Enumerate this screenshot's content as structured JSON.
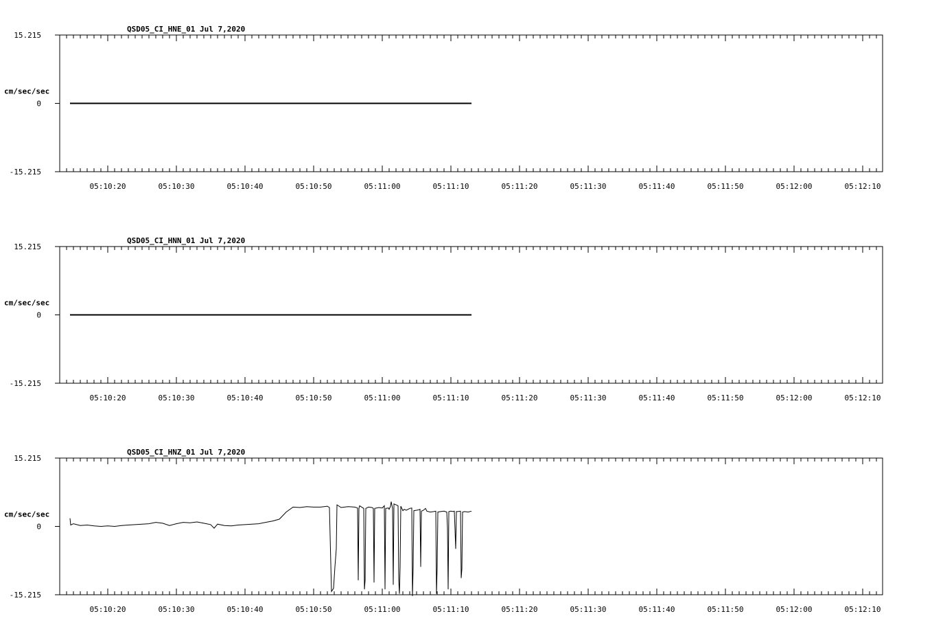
{
  "chart_data": [
    {
      "type": "line",
      "title": "QSD05_CI_HNE_01  Jul 7,2020",
      "ylabel": "cm/sec/sec",
      "ylim": [
        -15.215,
        15.215
      ],
      "ytick_labels": [
        "15.215",
        "0",
        "-15.215"
      ],
      "xtick_labels": [
        "05:10:20",
        "05:10:30",
        "05:10:40",
        "05:10:50",
        "05:11:00",
        "05:11:10",
        "05:11:20",
        "05:11:30",
        "05:11:40",
        "05:11:50",
        "05:12:00",
        "05:12:10"
      ],
      "series": [
        {
          "x_start_s": 14.5,
          "x_end_s": 73.0,
          "values": [
            [
              14.5,
              0.0
            ],
            [
              73.0,
              0.0
            ]
          ]
        }
      ]
    },
    {
      "type": "line",
      "title": "QSD05_CI_HNN_01  Jul 7,2020",
      "ylabel": "cm/sec/sec",
      "ylim": [
        -15.215,
        15.215
      ],
      "ytick_labels": [
        "15.215",
        "0",
        "-15.215"
      ],
      "xtick_labels": [
        "05:10:20",
        "05:10:30",
        "05:10:40",
        "05:10:50",
        "05:11:00",
        "05:11:10",
        "05:11:20",
        "05:11:30",
        "05:11:40",
        "05:11:50",
        "05:12:00",
        "05:12:10"
      ],
      "series": [
        {
          "values": [
            [
              14.5,
              0.0
            ],
            [
              73.0,
              0.0
            ]
          ]
        }
      ]
    },
    {
      "type": "line",
      "title": "QSD05_CI_HNZ_01  Jul 7,2020",
      "ylabel": "cm/sec/sec",
      "ylim": [
        -15.215,
        15.215
      ],
      "ytick_labels": [
        "15.215",
        "0",
        "-15.215"
      ],
      "xtick_labels": [
        "05:10:20",
        "05:10:30",
        "05:10:40",
        "05:10:50",
        "05:11:00",
        "05:11:10",
        "05:11:20",
        "05:11:30",
        "05:11:40",
        "05:11:50",
        "05:12:00",
        "05:12:10"
      ],
      "series": [
        {
          "values": [
            [
              14.5,
              1.8
            ],
            [
              14.6,
              0.3
            ],
            [
              15.0,
              0.6
            ],
            [
              16.0,
              0.2
            ],
            [
              17.0,
              0.3
            ],
            [
              18.0,
              0.1
            ],
            [
              19.0,
              0.0
            ],
            [
              20.0,
              0.1
            ],
            [
              21.0,
              0.0
            ],
            [
              22.0,
              0.2
            ],
            [
              23.0,
              0.3
            ],
            [
              24.0,
              0.4
            ],
            [
              25.0,
              0.5
            ],
            [
              26.0,
              0.6
            ],
            [
              27.0,
              0.9
            ],
            [
              28.0,
              0.7
            ],
            [
              29.0,
              0.2
            ],
            [
              30.0,
              0.6
            ],
            [
              31.0,
              0.9
            ],
            [
              32.0,
              0.8
            ],
            [
              33.0,
              1.0
            ],
            [
              34.0,
              0.7
            ],
            [
              35.0,
              0.4
            ],
            [
              35.5,
              -0.4
            ],
            [
              36.0,
              0.5
            ],
            [
              37.0,
              0.2
            ],
            [
              38.0,
              0.1
            ],
            [
              39.0,
              0.3
            ],
            [
              40.0,
              0.4
            ],
            [
              41.0,
              0.5
            ],
            [
              42.0,
              0.6
            ],
            [
              43.0,
              0.9
            ],
            [
              44.0,
              1.2
            ],
            [
              45.0,
              1.6
            ],
            [
              46.0,
              3.2
            ],
            [
              47.0,
              4.3
            ],
            [
              48.0,
              4.2
            ],
            [
              49.0,
              4.4
            ],
            [
              50.0,
              4.3
            ],
            [
              51.0,
              4.3
            ],
            [
              52.0,
              4.5
            ],
            [
              52.3,
              4.2
            ],
            [
              52.6,
              -14.5
            ],
            [
              52.9,
              -13.8
            ],
            [
              53.1,
              -9.0
            ],
            [
              53.3,
              -5.0
            ],
            [
              53.4,
              4.8
            ],
            [
              54.0,
              4.2
            ],
            [
              55.0,
              4.4
            ],
            [
              56.0,
              4.3
            ],
            [
              56.4,
              4.1
            ],
            [
              56.5,
              -12.0
            ],
            [
              56.6,
              4.0
            ],
            [
              56.7,
              4.6
            ],
            [
              57.0,
              4.3
            ],
            [
              57.3,
              4.0
            ],
            [
              57.4,
              -14.0
            ],
            [
              57.5,
              -12.0
            ],
            [
              57.6,
              4.0
            ],
            [
              58.0,
              4.3
            ],
            [
              58.5,
              4.2
            ],
            [
              58.7,
              4.0
            ],
            [
              58.8,
              -12.5
            ],
            [
              58.9,
              4.0
            ],
            [
              59.5,
              4.2
            ],
            [
              60.0,
              4.1
            ],
            [
              60.3,
              4.6
            ],
            [
              60.4,
              -14.0
            ],
            [
              60.5,
              4.0
            ],
            [
              60.9,
              4.1
            ],
            [
              61.0,
              3.8
            ],
            [
              61.2,
              4.5
            ],
            [
              61.3,
              5.5
            ],
            [
              61.5,
              4.0
            ],
            [
              61.6,
              -13.0
            ],
            [
              61.7,
              5.0
            ],
            [
              62.0,
              4.8
            ],
            [
              62.3,
              4.6
            ],
            [
              62.4,
              -12.0
            ],
            [
              62.5,
              -15.0
            ],
            [
              62.6,
              -9.0
            ],
            [
              62.7,
              4.5
            ],
            [
              63.0,
              3.5
            ],
            [
              63.2,
              3.8
            ],
            [
              63.5,
              3.6
            ],
            [
              64.0,
              4.0
            ],
            [
              64.3,
              4.1
            ],
            [
              64.4,
              -15.5
            ],
            [
              64.5,
              -9.0
            ],
            [
              64.6,
              3.5
            ],
            [
              65.0,
              3.6
            ],
            [
              65.3,
              3.7
            ],
            [
              65.5,
              3.8
            ],
            [
              65.6,
              -9.0
            ],
            [
              65.7,
              3.4
            ],
            [
              66.0,
              3.6
            ],
            [
              66.3,
              4.0
            ],
            [
              66.5,
              3.4
            ],
            [
              67.0,
              3.2
            ],
            [
              67.5,
              3.3
            ],
            [
              67.8,
              3.4
            ],
            [
              67.9,
              -15.0
            ],
            [
              68.0,
              -9.0
            ],
            [
              68.1,
              3.2
            ],
            [
              68.5,
              3.3
            ],
            [
              69.0,
              3.4
            ],
            [
              69.4,
              3.2
            ],
            [
              69.5,
              -0.3
            ],
            [
              69.6,
              -14.0
            ],
            [
              69.7,
              3.3
            ],
            [
              70.0,
              3.4
            ],
            [
              70.3,
              3.3
            ],
            [
              70.5,
              3.4
            ],
            [
              70.7,
              -5.0
            ],
            [
              70.8,
              3.3
            ],
            [
              71.0,
              3.3
            ],
            [
              71.4,
              3.4
            ],
            [
              71.5,
              -11.5
            ],
            [
              71.6,
              -9.5
            ],
            [
              71.7,
              3.2
            ],
            [
              72.0,
              3.3
            ],
            [
              72.5,
              3.2
            ],
            [
              73.0,
              3.4
            ]
          ]
        }
      ]
    }
  ]
}
